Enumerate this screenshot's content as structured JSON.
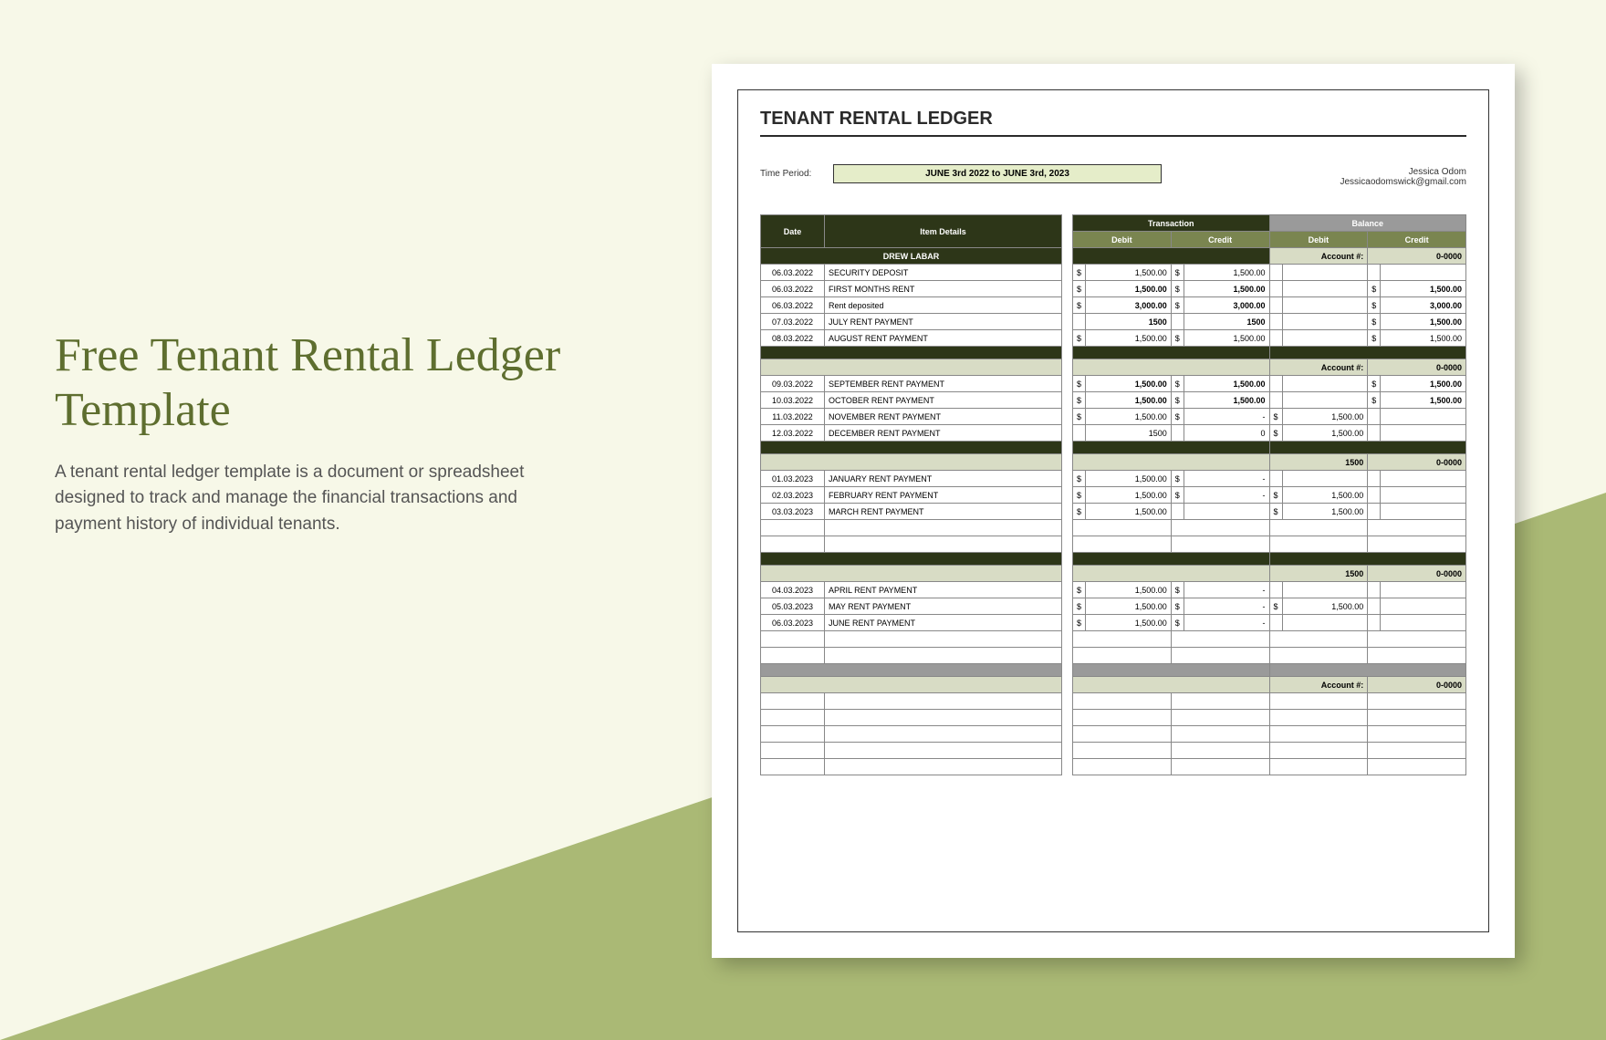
{
  "left": {
    "title": "Free Tenant Rental Ledger Template",
    "description": "A tenant rental ledger template is a document or spreadsheet designed to track and manage the financial transactions and payment history of individual tenants."
  },
  "doc": {
    "title": "TENANT RENTAL LEDGER",
    "period_label": "Time Period:",
    "period_value": "JUNE 3rd 2022 to JUNE 3rd, 2023",
    "contact_name": "Jessica Odom",
    "contact_email": "Jessicaodomswick@gmail.com",
    "headers": {
      "date": "Date",
      "item": "Item Details",
      "trans": "Transaction",
      "bal": "Balance",
      "debit": "Debit",
      "credit": "Credit",
      "acct": "Account #:",
      "acct_val": "0-0000",
      "tenant": "DREW LABAR"
    },
    "sections": [
      {
        "rows": [
          {
            "date": "06.03.2022",
            "item": "SECURITY DEPOSIT",
            "td": "$",
            "tdv": "1,500.00",
            "tc": "$",
            "tcv": "1,500.00",
            "bd": "",
            "bc": ""
          },
          {
            "date": "06.03.2022",
            "item": "FIRST MONTHS RENT",
            "td": "$",
            "tdv": "1,500.00",
            "tc": "$",
            "tcv": "1,500.00",
            "bd": "",
            "bc": "$",
            "bcv": "1,500.00",
            "bold": true
          },
          {
            "date": "06.03.2022",
            "item": "Rent deposited",
            "td": "$",
            "tdv": "3,000.00",
            "tc": "$",
            "tcv": "3,000.00",
            "bd": "",
            "bc": "$",
            "bcv": "3,000.00",
            "bold": true
          },
          {
            "date": "07.03.2022",
            "item": "JULY RENT PAYMENT",
            "td": "",
            "tdv": "1500",
            "tc": "",
            "tcv": "1500",
            "bd": "",
            "bc": "$",
            "bcv": "1,500.00",
            "bold": true
          },
          {
            "date": "08.03.2022",
            "item": "AUGUST RENT PAYMENT",
            "td": "$",
            "tdv": "1,500.00",
            "tc": "$",
            "tcv": "1,500.00",
            "bd": "",
            "bc": "$",
            "bcv": "1,500.00"
          }
        ]
      },
      {
        "rows": [
          {
            "date": "09.03.2022",
            "item": "SEPTEMBER RENT PAYMENT",
            "td": "$",
            "tdv": "1,500.00",
            "tc": "$",
            "tcv": "1,500.00",
            "bd": "",
            "bc": "$",
            "bcv": "1,500.00",
            "bold": true
          },
          {
            "date": "10.03.2022",
            "item": "OCTOBER RENT PAYMENT",
            "td": "$",
            "tdv": "1,500.00",
            "tc": "$",
            "tcv": "1,500.00",
            "bd": "",
            "bc": "$",
            "bcv": "1,500.00",
            "bold": true
          },
          {
            "date": "11.03.2022",
            "item": "NOVEMBER RENT PAYMENT",
            "td": "$",
            "tdv": "1,500.00",
            "tc": "$",
            "tcv": "-",
            "bd": "$",
            "bdv": "1,500.00",
            "bc": ""
          },
          {
            "date": "12.03.2022",
            "item": "DECEMBER RENT PAYMENT",
            "td": "",
            "tdv": "1500",
            "tc": "",
            "tcv": "0",
            "bd": "$",
            "bdv": "1,500.00",
            "bc": ""
          }
        ]
      },
      {
        "special_first": "1500",
        "rows": [
          {
            "date": "01.03.2023",
            "item": "JANUARY RENT PAYMENT",
            "td": "$",
            "tdv": "1,500.00",
            "tc": "$",
            "tcv": "-",
            "bd": "",
            "bc": ""
          },
          {
            "date": "02.03.2023",
            "item": "FEBRUARY RENT PAYMENT",
            "td": "$",
            "tdv": "1,500.00",
            "tc": "$",
            "tcv": "-",
            "bd": "$",
            "bdv": "1,500.00",
            "bc": ""
          },
          {
            "date": "03.03.2023",
            "item": "MARCH RENT PAYMENT",
            "td": "$",
            "tdv": "1,500.00",
            "tc": "",
            "bd": "$",
            "bdv": "1,500.00",
            "bc": ""
          }
        ],
        "empty": 2
      },
      {
        "special_first": "1500",
        "rows": [
          {
            "date": "04.03.2023",
            "item": "APRIL RENT PAYMENT",
            "td": "$",
            "tdv": "1,500.00",
            "tc": "$",
            "tcv": "-",
            "bd": "",
            "bc": ""
          },
          {
            "date": "05.03.2023",
            "item": "MAY RENT PAYMENT",
            "td": "$",
            "tdv": "1,500.00",
            "tc": "$",
            "tcv": "-",
            "bd": "$",
            "bdv": "1,500.00",
            "bc": ""
          },
          {
            "date": "06.03.2023",
            "item": "JUNE RENT PAYMENT",
            "td": "$",
            "tdv": "1,500.00",
            "tc": "$",
            "tcv": "-",
            "bd": "",
            "bc": ""
          }
        ],
        "empty": 2
      },
      {
        "rows": [],
        "empty": 5
      }
    ]
  }
}
